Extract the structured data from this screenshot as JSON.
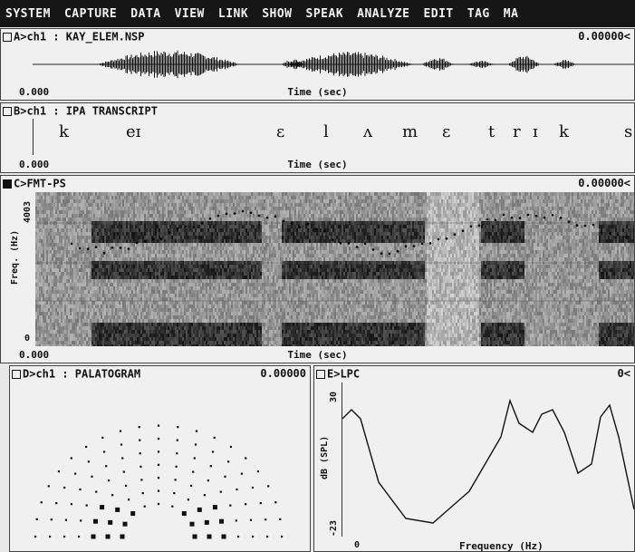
{
  "menu": {
    "items": [
      "SYSTEM",
      "CAPTURE",
      "DATA",
      "VIEW",
      "LINK",
      "SHOW",
      "SPEAK",
      "ANALYZE",
      "EDIT",
      "TAG",
      "MA"
    ]
  },
  "panel_a": {
    "label": "A>ch1 : KAY_ELEM.NSP",
    "value": "0.00000<",
    "time_start": "0.000",
    "axis_label": "Time (sec)"
  },
  "panel_b": {
    "label": "B>ch1 : IPA TRANSCRIPT",
    "phonemes": [
      "k",
      "eɪ",
      "ɛ",
      "l",
      "ʌ",
      "m",
      "ɛ",
      "t",
      "r",
      "ɪ",
      "k",
      "s"
    ],
    "time_start": "0.000",
    "axis_label": "Time (sec)"
  },
  "panel_c": {
    "label": "C>FMT-PS",
    "value": "0.00000<",
    "y_label": "Freq. (Hz)",
    "y_max": "4003",
    "y_min": "0",
    "time_start": "0.000",
    "axis_label": "Time (sec)"
  },
  "panel_d": {
    "label": "D>ch1 : PALATOGRAM",
    "value": "0.00000"
  },
  "panel_e": {
    "label": "E>LPC",
    "value": "0<",
    "y_label": "dB (SPL)",
    "y_max": "30",
    "y_min": "-23",
    "x_start": "0",
    "x_label": "Frequency (Hz)"
  }
}
